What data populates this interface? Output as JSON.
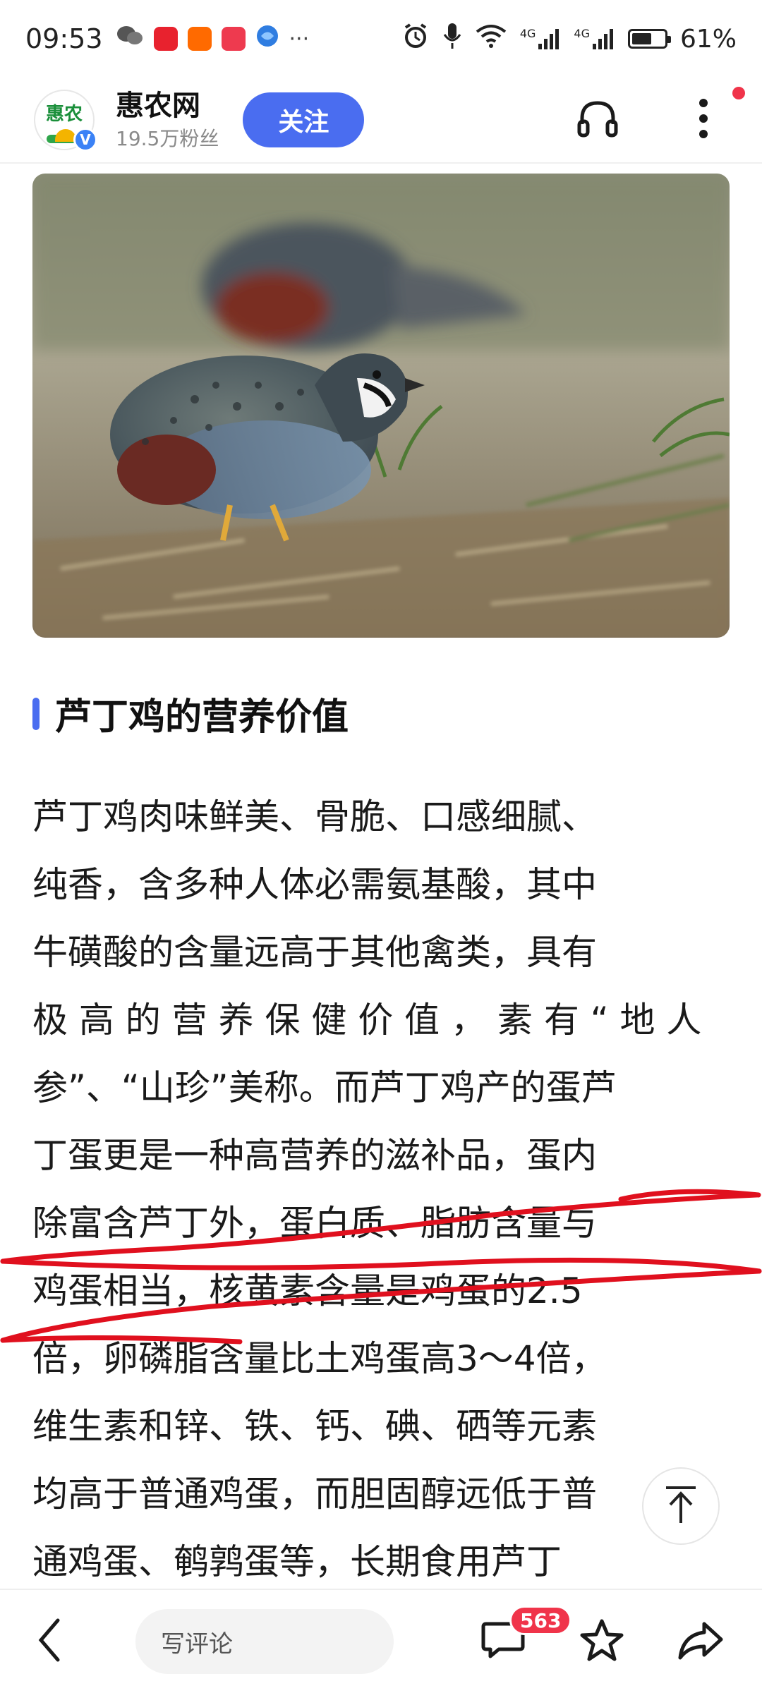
{
  "status_bar": {
    "time": "09:53",
    "more": "···",
    "network": "4G",
    "battery": "61%",
    "battery_level": 0.61,
    "app_icons": [
      "wechat-icon",
      "app-icon",
      "taobao-icon",
      "app-icon",
      "browser-icon"
    ]
  },
  "header": {
    "logo_text": "惠农",
    "verified_mark": "V",
    "channel_name": "惠农网",
    "fans": "19.5万粉丝",
    "follow_label": "关注"
  },
  "article": {
    "section_title": "芦丁鸡的营养价值",
    "paragraph_lines": [
      "芦丁鸡肉味鲜美、骨脆、口感细腻、",
      "纯香，含多种人体必需氨基酸，其中",
      "牛磺酸的含量远高于其他禽类，具有",
      "极 高 的 营 养 保 健 价 值 ， 素 有 “ 地 人",
      "参”、“山珍”美称。而芦丁鸡产的蛋芦",
      "丁蛋更是一种高营养的滋补品，蛋内",
      "除富含芦丁外，蛋白质、脂肪含量与",
      "鸡蛋相当，核黄素含量是鸡蛋的2.5",
      "倍，卵磷脂含量比土鸡蛋高3～4倍，",
      "维生素和锌、铁、钙、碘、硒等元素",
      "均高于普通鸡蛋，而胆固醇远低于普",
      "通鸡蛋、鹌鹑蛋等，长期食用芦丁"
    ]
  },
  "bottom_bar": {
    "comment_placeholder": "写评论",
    "comment_count": "563"
  },
  "colors": {
    "accent": "#4a6df0",
    "badge_red": "#f0344a",
    "underline_red": "#e0101e"
  }
}
